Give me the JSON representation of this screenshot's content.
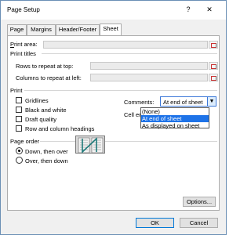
{
  "window": {
    "title": "Page Setup",
    "help": "?",
    "close": "✕"
  },
  "tabs": [
    "Page",
    "Margins",
    "Header/Footer",
    "Sheet"
  ],
  "print_area": {
    "label": "Print area:",
    "value": ""
  },
  "print_titles": {
    "heading": "Print titles",
    "rows_label": "Rows to repeat at top:",
    "cols_label": "Columns to repeat at left:"
  },
  "print": {
    "heading": "Print",
    "gridlines": "Gridlines",
    "black_white": "Black and white",
    "draft": "Draft quality",
    "headings": "Row and column headings",
    "comments_label": "Comments:",
    "comments_value": "At end of sheet",
    "errors_label": "Cell errors as:",
    "dropdown_options": [
      "(None)",
      "At end of sheet",
      "As displayed on sheet"
    ]
  },
  "page_order": {
    "heading": "Page order",
    "down_over": "Down, then over",
    "over_down": "Over, then down"
  },
  "buttons": {
    "options": "Options...",
    "ok": "OK",
    "cancel": "Cancel"
  }
}
